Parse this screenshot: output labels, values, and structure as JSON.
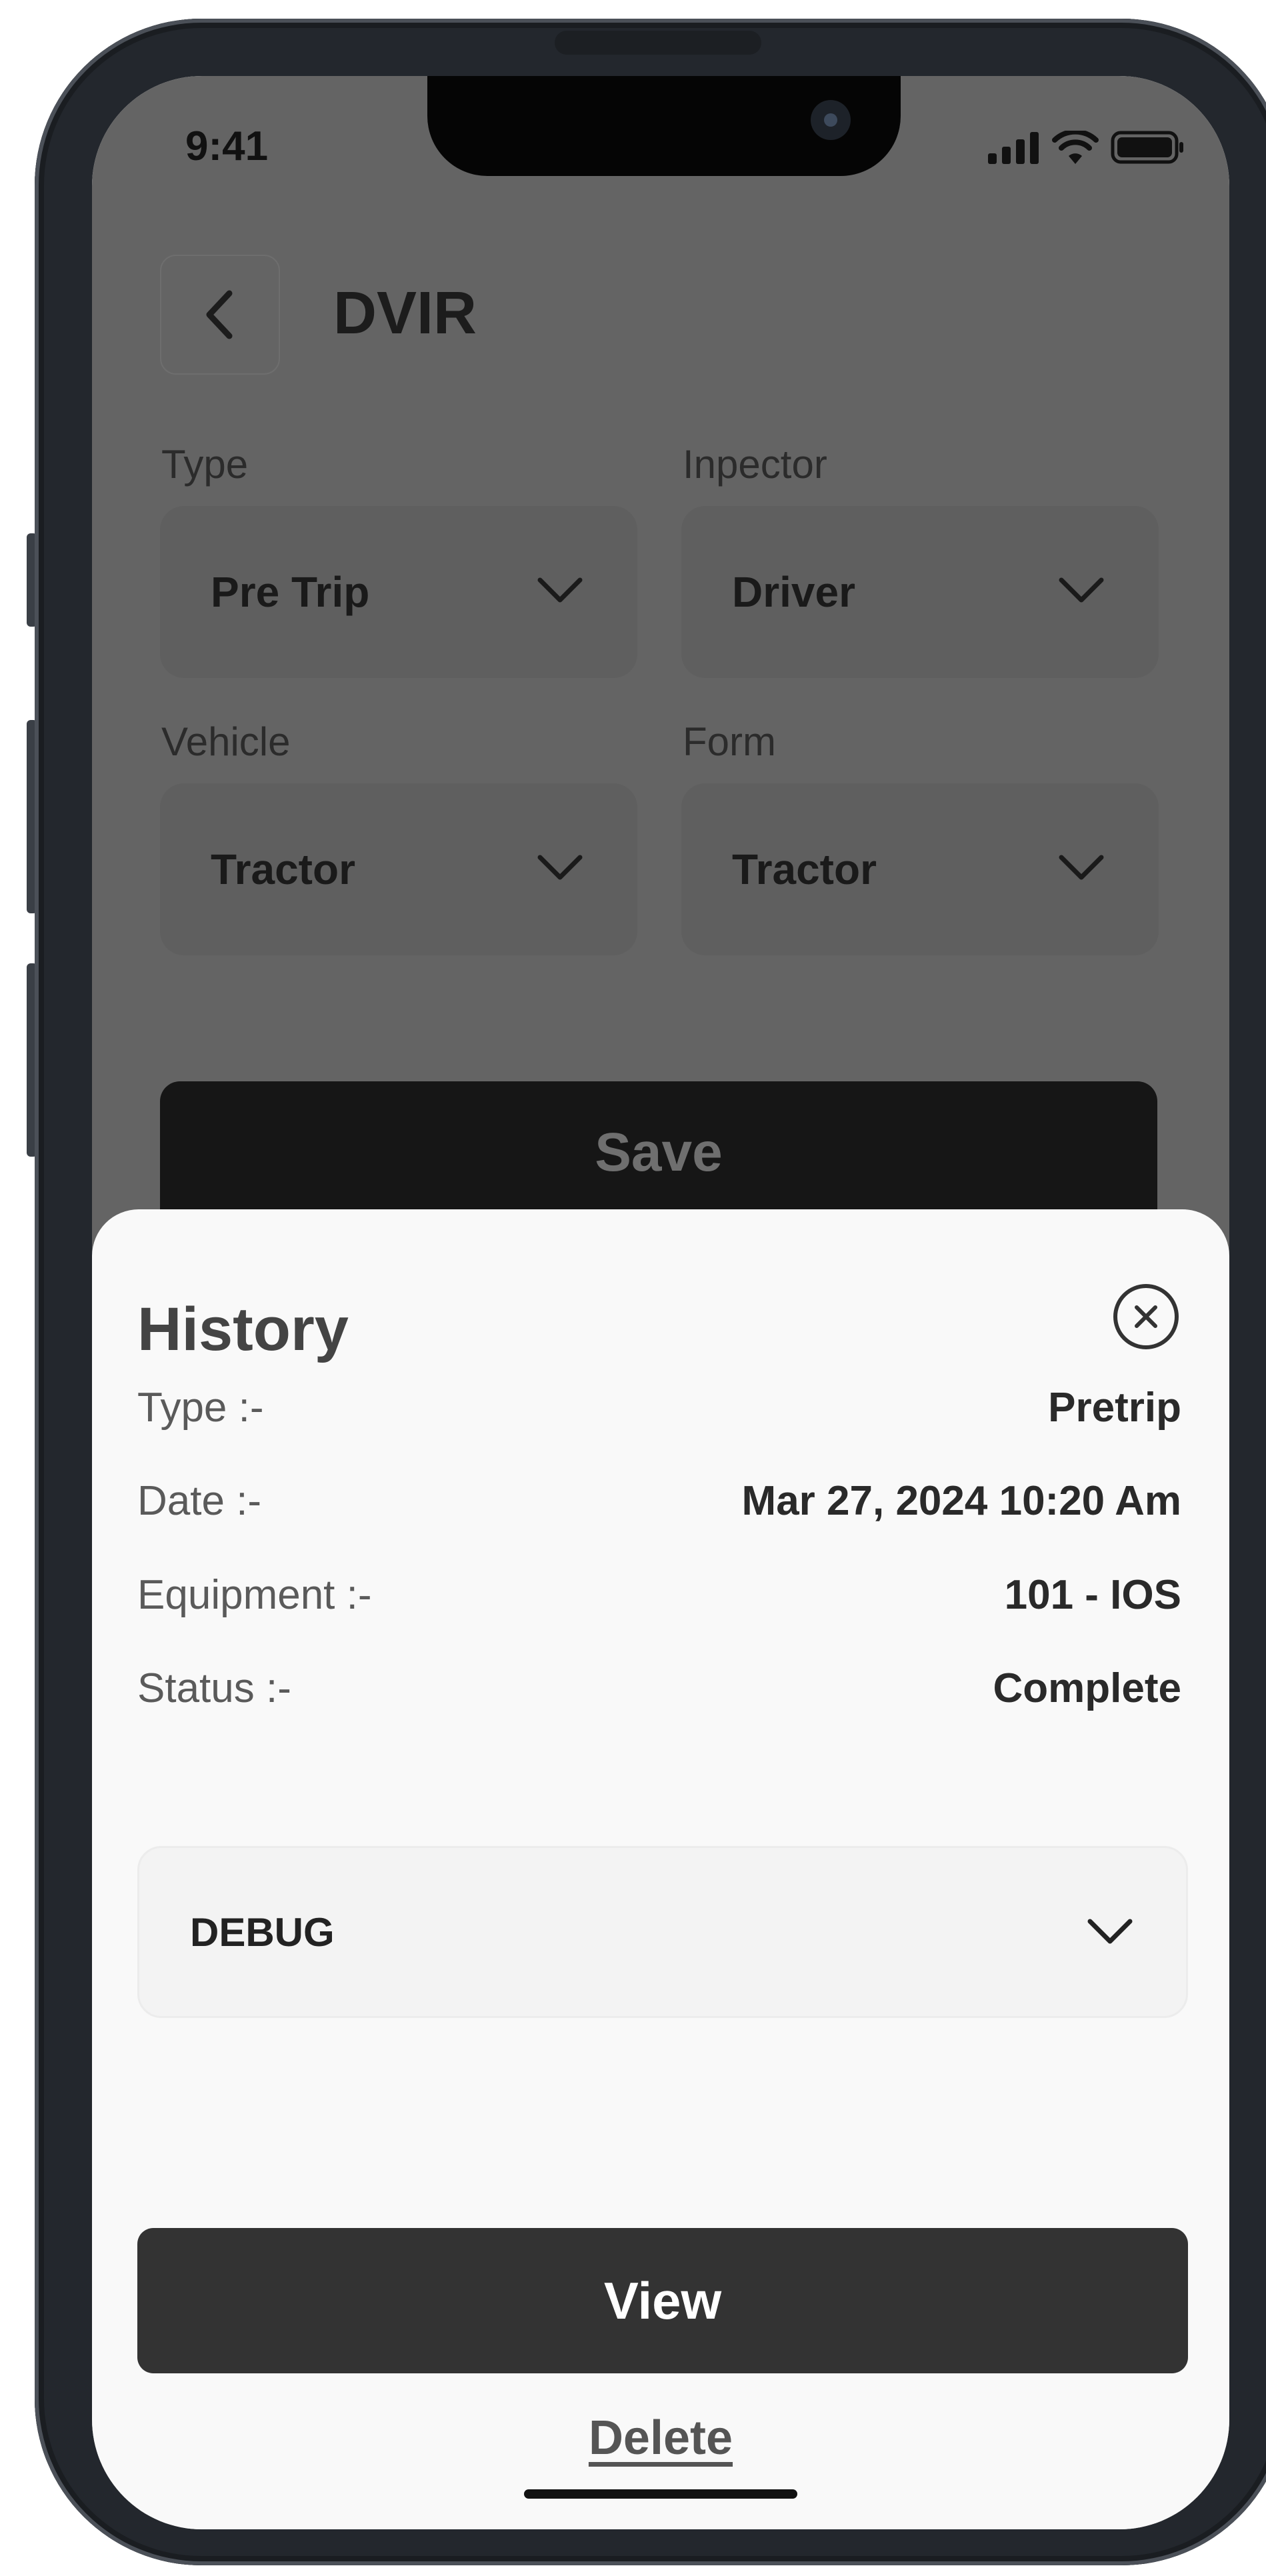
{
  "status_bar": {
    "time": "9:41"
  },
  "header": {
    "title": "DVIR"
  },
  "form": {
    "type": {
      "label": "Type",
      "value": "Pre Trip"
    },
    "inspector": {
      "label": "Inpector",
      "value": "Driver"
    },
    "vehicle": {
      "label": "Vehicle",
      "value": "Tractor"
    },
    "form": {
      "label": "Form",
      "value": "Tractor"
    },
    "save_label": "Save"
  },
  "history": {
    "title": "History",
    "rows": [
      {
        "label": "Type :-",
        "value": "Pretrip"
      },
      {
        "label": "Date :-",
        "value": "Mar 27, 2024 10:20 Am"
      },
      {
        "label": "Equipment :-",
        "value": "101 - IOS"
      },
      {
        "label": "Status :-",
        "value": "Complete"
      }
    ],
    "debug_select": {
      "value": "DEBUG"
    },
    "view_label": "View",
    "delete_label": "Delete"
  },
  "icons": {
    "back": "chevron-left-icon",
    "dropdown": "chevron-down-icon",
    "close": "close-circle-icon",
    "signal": "signal-icon",
    "wifi": "wifi-icon",
    "battery": "battery-icon"
  },
  "colors": {
    "overlay": "#646464",
    "sheet_background": "#f9f9f9",
    "primary_button": "#333333",
    "save_button": "#161616"
  }
}
